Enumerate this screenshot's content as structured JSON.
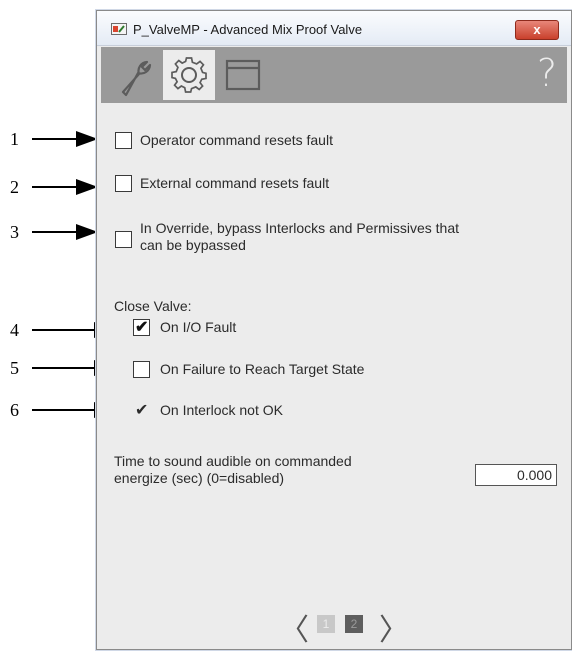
{
  "window": {
    "title": "P_ValveMP - Advanced Mix Proof Valve",
    "close_label": "x"
  },
  "toolbar": {
    "tabs": [
      {
        "name": "maintenance",
        "icon": "wrench-icon"
      },
      {
        "name": "engineering",
        "icon": "gear-icon"
      },
      {
        "name": "trends",
        "icon": "window-icon"
      }
    ],
    "help_label": "?"
  },
  "callouts": [
    "1",
    "2",
    "3",
    "4",
    "5",
    "6"
  ],
  "options": [
    {
      "label": "Operator command resets fault",
      "checked": false
    },
    {
      "label": "External command resets fault",
      "checked": false
    },
    {
      "label_line1": "In Override, bypass Interlocks and Permissives that",
      "label_line2": "can be bypassed",
      "checked": false
    }
  ],
  "close_valve": {
    "heading": "Close Valve:",
    "items": [
      {
        "label": "On I/O Fault",
        "checked": true
      },
      {
        "label": "On Failure to Reach Target State",
        "checked": false
      },
      {
        "label": "On Interlock not OK",
        "checked": true
      }
    ]
  },
  "audible": {
    "label_line1": "Time to sound audible on commanded",
    "label_line2": "energize (sec) (0=disabled)",
    "value": "0.000"
  },
  "pager": {
    "prev": "〈",
    "next": "〉",
    "pages": [
      "1",
      "2"
    ],
    "current": "2"
  }
}
